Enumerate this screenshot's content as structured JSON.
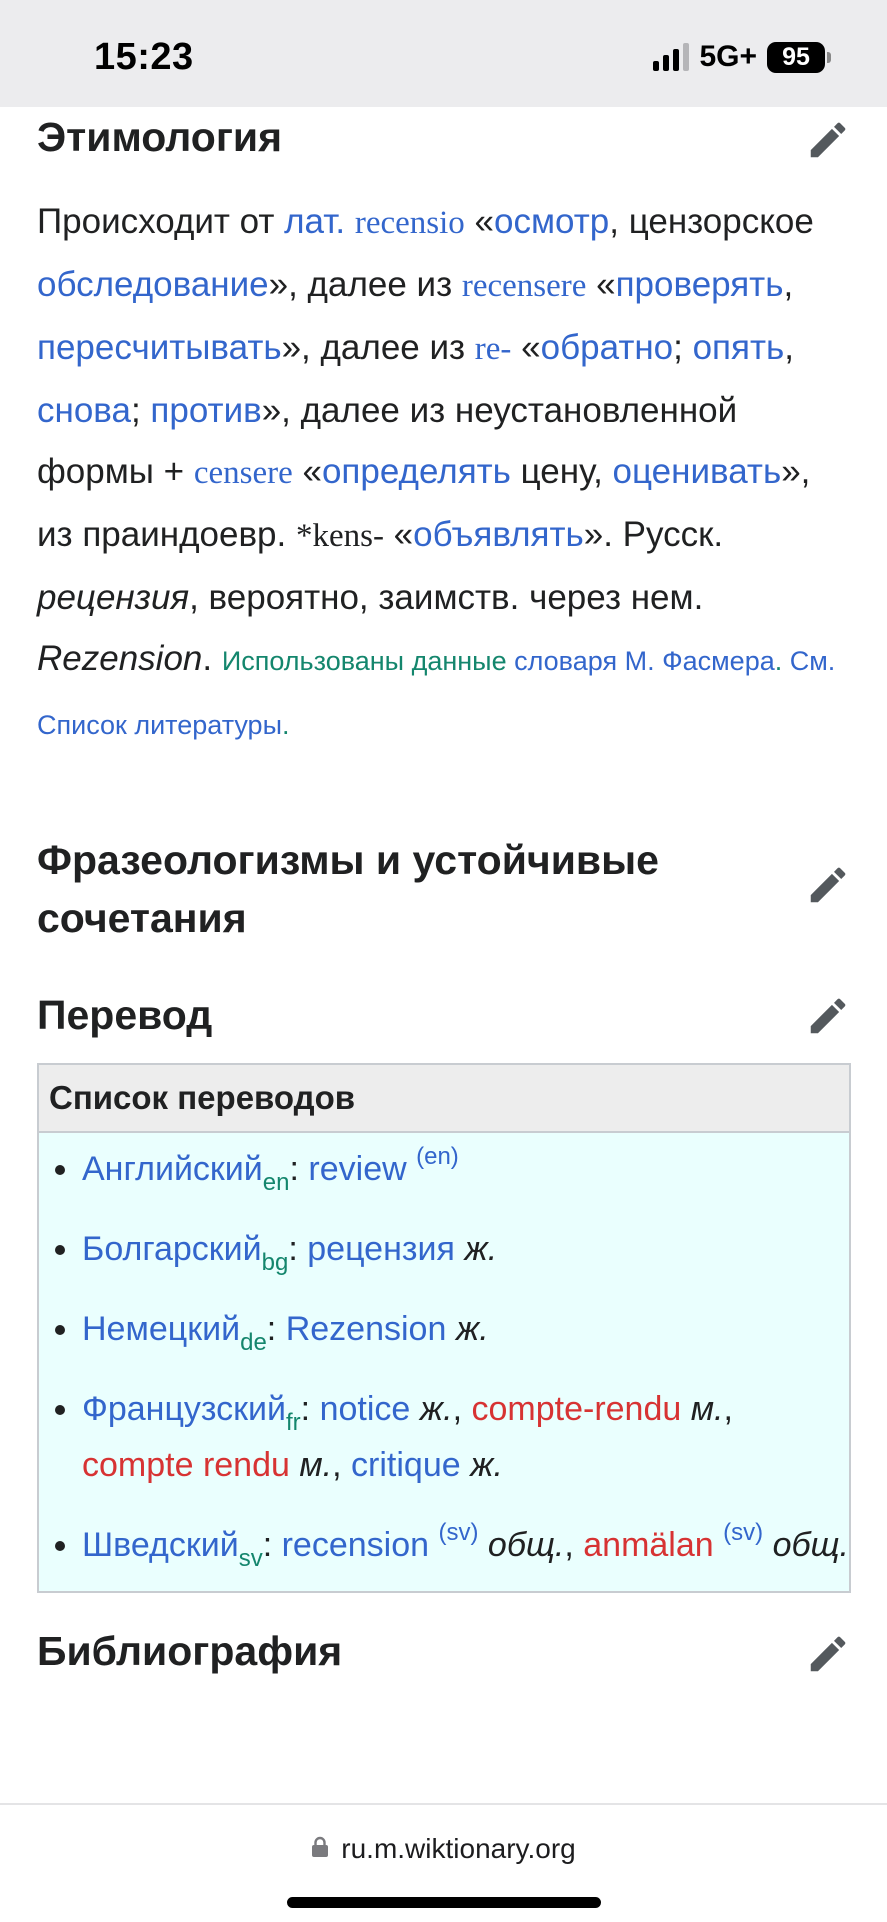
{
  "status_bar": {
    "time": "15:23",
    "network": "5G+",
    "battery": "95"
  },
  "sections": {
    "etymology_title": "Этимология",
    "phraseology_title": "Фразеологизмы и устойчивые сочетания",
    "translation_title": "Перевод",
    "bibliography_title": "Библиография"
  },
  "etymology": {
    "t01": "Происходит от ",
    "l_lat": "лат.",
    "t02": " ",
    "l_recensio": "recensio",
    "t03": " «",
    "l_osmotr": "осмотр",
    "t04": ", цензорское ",
    "l_obsledovanie": "обследование",
    "t05": "», далее из ",
    "l_recensere": "recensere",
    "t06": " «",
    "l_proveryat": "проверять",
    "t07": ", ",
    "l_pereschityvat": "пересчитывать",
    "t08": "», далее из ",
    "l_re": "re-",
    "t09": " «",
    "l_obratno": "обратно",
    "t10": "; ",
    "l_opyat": "опять",
    "t11": ", ",
    "l_snova": "снова",
    "t12": "; ",
    "l_protiv": "против",
    "t13": "», далее из неустановленной формы + ",
    "l_censere": "censere",
    "t14": " «",
    "l_opredelyat": "определять",
    "t15": " цену, ",
    "l_otsenivat": "оценивать",
    "t16": "», из праиндоевр. ",
    "kens": "*kens-",
    "t17": " «",
    "l_obyavlyat": "объявлять",
    "t18": "». Русск. ",
    "retsenziya": "рецензия",
    "t19": ", вероятно, заимств. через нем. ",
    "rezension": "Rezension",
    "t20": ". ",
    "used_data": "Использованы данные ",
    "l_slovarya": "словаря М. Фасмера",
    "t21": ". ",
    "l_see": "См. Список литературы",
    "t22": "."
  },
  "translations": {
    "header": "Список переводов",
    "en": {
      "lang": "Английский",
      "code": "en",
      "sep": ": ",
      "w1": "review",
      "sup": "(en)"
    },
    "bg": {
      "lang": "Болгарский",
      "code": "bg",
      "sep": ": ",
      "w1": "рецензия",
      "g1": "ж."
    },
    "de": {
      "lang": "Немецкий",
      "code": "de",
      "sep": ": ",
      "w1": "Rezension",
      "g1": "ж."
    },
    "fr": {
      "lang": "Французский",
      "code": "fr",
      "sep": ": ",
      "w1": "notice",
      "g1": "ж.",
      "c1": ", ",
      "w2": "compte-rendu",
      "g2": "м.",
      "c2": ", ",
      "w3": "compte rendu",
      "g3": "м.",
      "c3": ", ",
      "w4": "critique",
      "g4": "ж."
    },
    "sv": {
      "lang": "Шведский",
      "code": "sv",
      "sep": ": ",
      "w1": "recension",
      "sup1": "(sv)",
      "g1": "общ.",
      "c1": ", ",
      "w2": "anmälan",
      "sup2": "(sv)",
      "g2": "общ."
    }
  },
  "browser": {
    "url": "ru.m.wiktionary.org"
  }
}
